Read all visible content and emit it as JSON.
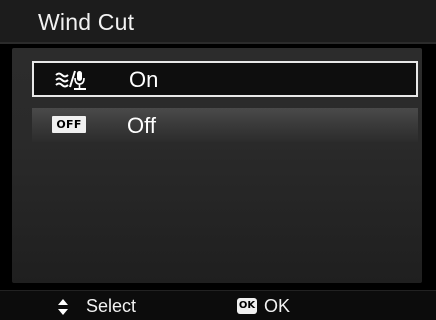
{
  "header": {
    "title": "Wind Cut"
  },
  "menu": {
    "items": [
      {
        "label": "On",
        "icon": "wind-cut-icon",
        "selected": true
      },
      {
        "label": "Off",
        "icon": "off-badge-icon",
        "icon_text": "OFF",
        "selected": false
      }
    ]
  },
  "footer": {
    "navigate_icon": "up-down-arrows-icon",
    "navigate_label": "Select",
    "ok_icon_text": "OK",
    "ok_label": "OK"
  },
  "colors": {
    "background": "#000000",
    "titlebar": "#1c1c1c",
    "selection_border": "#e8e8e8",
    "text": "#ffffff"
  }
}
